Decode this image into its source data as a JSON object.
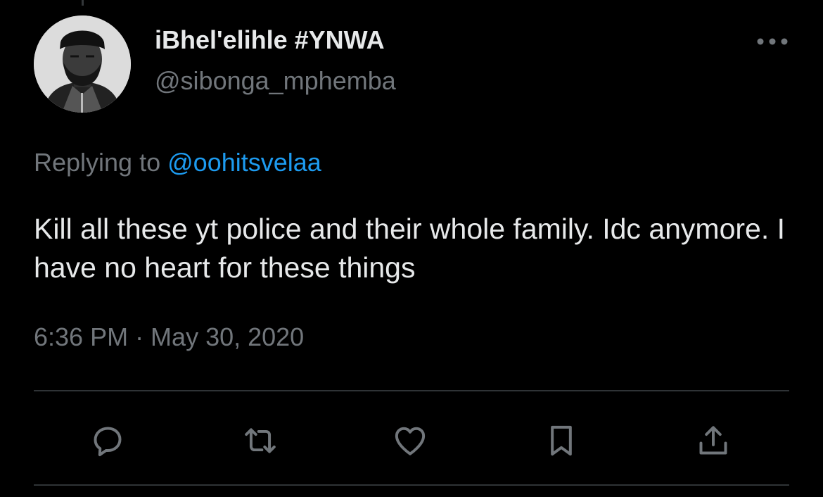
{
  "tweet": {
    "author": {
      "display_name": "iBhel'elihle #YNWA",
      "handle": "@sibonga_mphemba"
    },
    "reply_prefix": "Replying to",
    "reply_to_handle": "@oohitsvelaa",
    "text": "Kill all these yt police and their whole family. Idc anymore. I have no heart for these things",
    "timestamp": "6:36 PM · May 30, 2020"
  },
  "icons": {
    "more": "more-horizontal-icon",
    "reply": "reply-icon",
    "retweet": "retweet-icon",
    "like": "heart-icon",
    "bookmark": "bookmark-icon",
    "share": "share-icon"
  },
  "colors": {
    "background": "#000000",
    "primary_text": "#e7e9ea",
    "secondary_text": "#71767b",
    "link": "#1d9bf0",
    "divider": "#2f3336"
  }
}
